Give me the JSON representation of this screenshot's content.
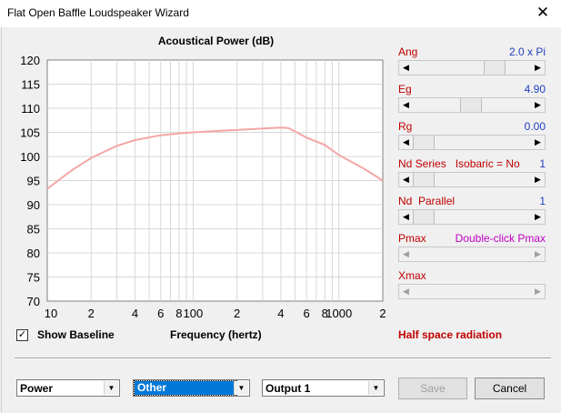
{
  "window": {
    "title": "Flat Open Baffle Loudspeaker Wizard",
    "close_glyph": "✕"
  },
  "chart_data": {
    "type": "line",
    "title": "Acoustical Power (dB)",
    "xlabel": "Frequency (hertz)",
    "ylabel": "",
    "x_scale": "log",
    "xlim": [
      10,
      2000
    ],
    "ylim": [
      70,
      120
    ],
    "grid": true,
    "line_color": "#f4a6a6",
    "yticks": [
      120,
      115,
      110,
      105,
      100,
      95,
      90,
      85,
      80,
      75,
      70
    ],
    "xticks": [
      {
        "v": 10,
        "label": "10"
      },
      {
        "v": 20,
        "label": "2"
      },
      {
        "v": 40,
        "label": "4"
      },
      {
        "v": 60,
        "label": "6"
      },
      {
        "v": 80,
        "label": "8"
      },
      {
        "v": 100,
        "label": "100"
      },
      {
        "v": 200,
        "label": "2"
      },
      {
        "v": 400,
        "label": "4"
      },
      {
        "v": 600,
        "label": "6"
      },
      {
        "v": 800,
        "label": "8"
      },
      {
        "v": 1000,
        "label": "1000"
      },
      {
        "v": 2000,
        "label": "2"
      }
    ],
    "series": [
      {
        "x": [
          10,
          15,
          20,
          30,
          40,
          60,
          80,
          100,
          150,
          200,
          300,
          400,
          450,
          500,
          600,
          800,
          1000,
          1500,
          2000
        ],
        "y": [
          93.3,
          97.3,
          99.7,
          102.2,
          103.4,
          104.4,
          104.8,
          105.0,
          105.3,
          105.5,
          105.8,
          106.0,
          105.9,
          105.2,
          103.9,
          102.4,
          100.3,
          97.4,
          95.0
        ]
      }
    ]
  },
  "controls": {
    "ang": {
      "label": "Ang",
      "value": "2.0 x Pi",
      "level": 0.72
    },
    "eg": {
      "label": "Eg",
      "value": "4.90",
      "level": 0.48
    },
    "rg": {
      "label": "Rg",
      "value": "0.00",
      "level": 0.0
    },
    "nd_series": {
      "label": "Nd Series   Isobaric = No",
      "value": "1",
      "level": 0.0
    },
    "nd_parallel": {
      "label": "Nd  Parallel",
      "value": "1",
      "level": 0.0
    },
    "pmax": {
      "label": "Pmax",
      "value": "Double-click Pmax"
    },
    "xmax": {
      "label": "Xmax"
    }
  },
  "checkbox": {
    "label": "Show Baseline",
    "checked": "✓"
  },
  "status": {
    "half_space": "Half space radiation"
  },
  "dropdowns": {
    "power": "Power",
    "other": "Other",
    "output": "Output 1"
  },
  "buttons": {
    "save": "Save",
    "cancel": "Cancel"
  }
}
